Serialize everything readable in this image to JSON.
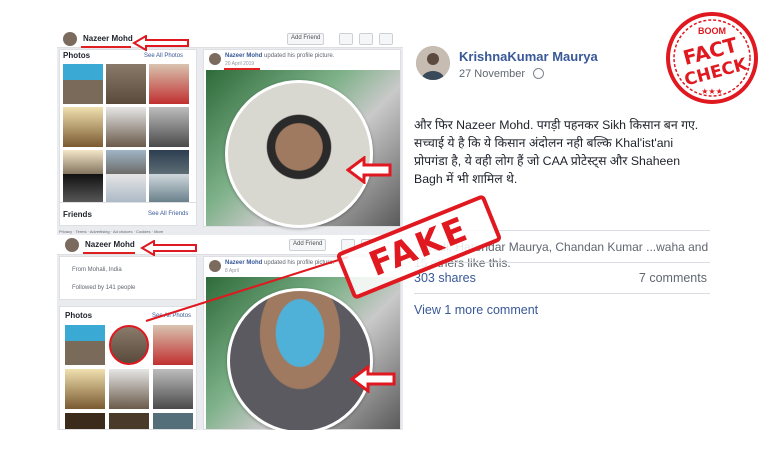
{
  "left_screens": {
    "top_profile": {
      "name": "Nazeer Mohd",
      "photos_label": "Photos",
      "see_all_photos": "See All Photos",
      "add_friend": "Add Friend"
    },
    "top_post": {
      "author": "Nazeer Mohd",
      "action": "updated his profile picture.",
      "date": "20 April 2019"
    },
    "friends_panel": {
      "title": "Friends",
      "see_all": "See All Friends",
      "footer": "Privacy · Terms · Advertising · Ad choices · Cookies · More"
    },
    "bottom_profile": {
      "name": "Nazeer Mohd",
      "add_friend": "Add Friend",
      "from": "From Mohali, India",
      "followed_by": "Followed by 141 people",
      "photos_label": "Photos",
      "see_all_photos": "See All Photos"
    },
    "bottom_post": {
      "author": "Nazeer Mohd",
      "action": "updated his profile picture.",
      "date": "8 April"
    }
  },
  "overlays": {
    "fake_stamp": "FAKE",
    "badge": {
      "top": "BOOM",
      "line1": "FACT",
      "line2": "CHECK",
      "color": "#e0181f"
    }
  },
  "post": {
    "author": "KrishnaKumar Maurya",
    "time": "27 November",
    "body": "और फिर Nazeer Mohd. पगड़ी पहनकर Sikh किसान बन गए. सच्चाई ये है कि ये किसान अंदोलन नही बल्कि Khal'ist'ani प्रोपगंडा है, ये वही लोग हैं जो CAA प्रोटेस्ट्स और Shaheen Bagh में भी शामिल थे.",
    "likes": "...wedi, Harendar Maurya, Chandan Kumar ...waha and 15 others like this.",
    "shares": "303 shares",
    "comments": "7 comments",
    "view_more": "View 1 more comment",
    "link_color": "#385898"
  }
}
